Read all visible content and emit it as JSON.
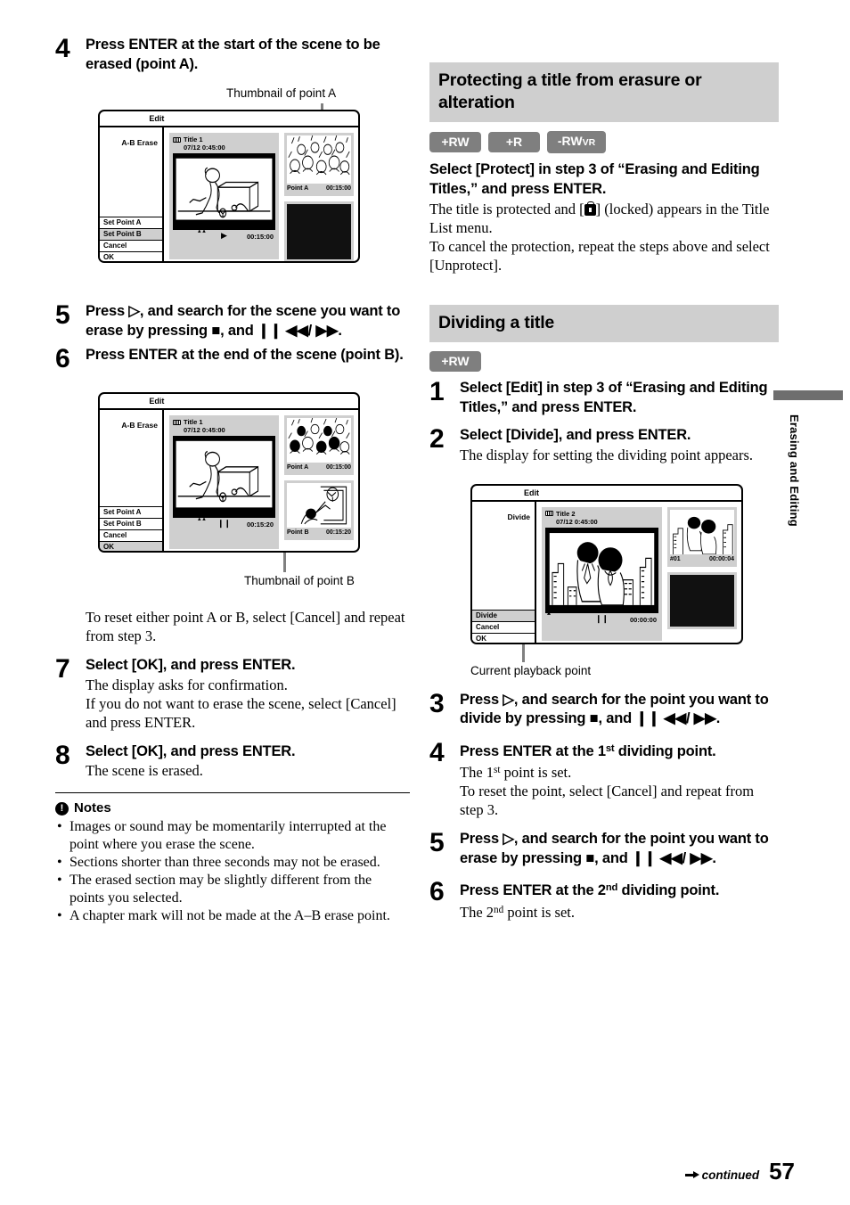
{
  "page_number": "57",
  "footer": {
    "continued": "continued"
  },
  "side_tab": {
    "label": "Erasing and Editing"
  },
  "left_column": {
    "step4": {
      "num": "4",
      "head": "Press ENTER at the start of the scene to be erased (point A).",
      "caption": "Thumbnail of point A"
    },
    "screen1": {
      "title": "Edit",
      "mode": "A-B Erase",
      "menu": [
        "Set Point A",
        "Set Point B",
        "Cancel",
        "OK"
      ],
      "selected": "Set Point B",
      "preview": {
        "title": "Title 1",
        "date": "07/12  0:45:00",
        "transport": "play",
        "time": "00:15:00"
      },
      "thumbnails": [
        {
          "label": "Point A",
          "time": "00:15:00",
          "image": "crowd-cheering"
        },
        {
          "label": "",
          "time": "",
          "image": "blank"
        }
      ]
    },
    "step5": {
      "num": "5",
      "head_pre": "Press",
      "head_mid": ", and search for the scene you want to erase by pressing",
      "head_sep": ", and",
      "head_end": "."
    },
    "step6": {
      "num": "6",
      "head": "Press ENTER at the end of the scene (point B)."
    },
    "screen2": {
      "title": "Edit",
      "mode": "A-B Erase",
      "menu": [
        "Set Point A",
        "Set Point B",
        "Cancel",
        "OK"
      ],
      "selected": "OK",
      "preview": {
        "title": "Title 1",
        "date": "07/12  0:45:00",
        "transport": "pause",
        "time": "00:15:20"
      },
      "thumbnails": [
        {
          "label": "Point A",
          "time": "00:15:00",
          "image": "crowd-cheering"
        },
        {
          "label": "Point B",
          "time": "00:15:20",
          "image": "goalkeeper-save"
        }
      ],
      "caption": "Thumbnail of point B"
    },
    "reset_note": "To reset either point A or B, select [Cancel] and repeat from step 3.",
    "step7": {
      "num": "7",
      "head": "Select [OK], and press ENTER.",
      "desc1": "The display asks for confirmation.",
      "desc2": "If you do not want to erase the scene, select [Cancel] and press ENTER."
    },
    "step8": {
      "num": "8",
      "head": "Select [OK], and press ENTER.",
      "desc1": "The scene is erased."
    },
    "notes": {
      "heading": "Notes",
      "items": [
        "Images or sound may be momentarily interrupted at the point where you erase the scene.",
        "Sections shorter than three seconds may not be erased.",
        "The erased section may be slightly different from the points you selected.",
        "A chapter mark will not be made at the A–B erase point."
      ]
    }
  },
  "right_column": {
    "section1": {
      "heading": "Protecting a title from erasure or alteration",
      "badges": [
        {
          "main": "+RW",
          "sub": ""
        },
        {
          "main": "+R",
          "sub": ""
        },
        {
          "main": "-RW",
          "sub": "VR"
        }
      ],
      "head": "Select [Protect] in step 3 of “Erasing and Editing Titles,” and press ENTER.",
      "desc_a1": "The title is protected and [",
      "desc_a2": "] (locked) appears in the Title List menu.",
      "desc_b": "To cancel the protection, repeat the steps above and select [Unprotect]."
    },
    "section2": {
      "heading": "Dividing a title",
      "badges": [
        {
          "main": "+RW",
          "sub": ""
        }
      ],
      "step1": {
        "num": "1",
        "head": "Select [Edit] in step 3 of “Erasing and Editing Titles,” and press ENTER."
      },
      "step2": {
        "num": "2",
        "head": "Select [Divide], and press ENTER.",
        "desc": "The display for setting the dividing point appears."
      },
      "screen3": {
        "title": "Edit",
        "mode": "Divide",
        "menu": [
          "Divide",
          "Cancel",
          "OK"
        ],
        "selected": "Divide",
        "preview": {
          "title": "Title 2",
          "date": "07/12  0:45:00",
          "transport": "pause",
          "time": "00:00:00"
        },
        "thumbnails": [
          {
            "label": "#01",
            "time": "00:00:04",
            "image": "two-people-city"
          },
          {
            "label": "",
            "time": "",
            "image": "blank"
          }
        ],
        "caption": "Current playback point"
      },
      "step3": {
        "num": "3",
        "head_pre": "Press",
        "head_mid": ", and search for the point you want to divide by pressing",
        "head_sep": ", and",
        "head_end": "."
      },
      "step4": {
        "num": "4",
        "head_pre": "Press ENTER at the 1",
        "head_sup": "st",
        "head_post": " dividing point.",
        "desc1_pre": "The 1",
        "desc1_sup": "st",
        "desc1_post": " point is set.",
        "desc2": "To reset the point, select [Cancel] and repeat from step 3."
      },
      "step5": {
        "num": "5",
        "head_pre": "Press",
        "head_mid": ", and search for the point you want to erase by pressing",
        "head_sep": ", and",
        "head_end": "."
      },
      "step6": {
        "num": "6",
        "head_pre": "Press ENTER at the 2",
        "head_sup": "nd",
        "head_post": " dividing point.",
        "desc1_pre": "The 2",
        "desc1_sup": "nd",
        "desc1_post": " point is set."
      }
    }
  },
  "icons": {
    "play_outline": "▷",
    "stop": "■",
    "pause": "❙❙",
    "rew": "◀◀",
    "ff": "▶▶",
    "slash": "/",
    "play_solid": "▶"
  },
  "colors": {
    "section_head_bg": "#cfcfcf",
    "badge_bg": "#7f7f7f",
    "screen_panel_bg": "#cfcfcf",
    "selected_row_bg": "#cfcfcf",
    "leader_line": "#808080",
    "side_tab_bar": "#6e6e6e"
  }
}
